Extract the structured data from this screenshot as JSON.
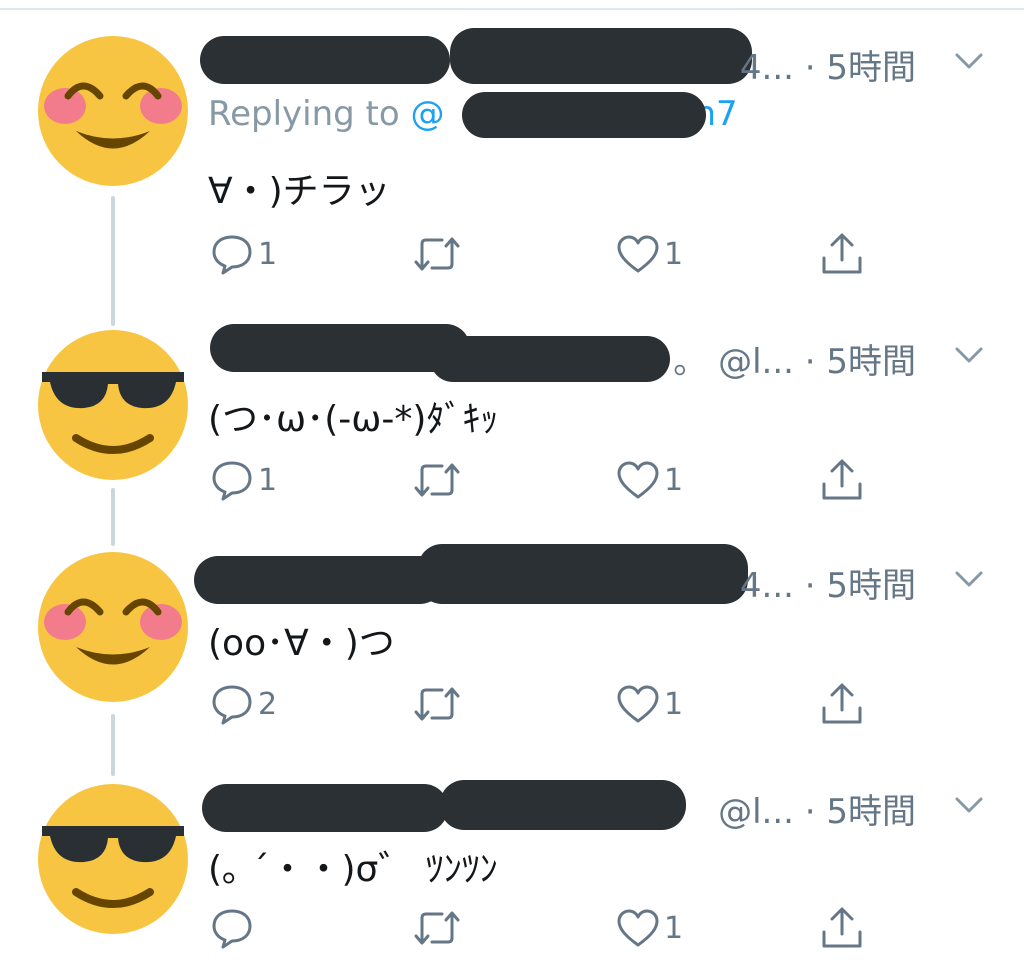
{
  "tweets": [
    {
      "avatar": "smiling-blush-emoji",
      "meta": "4... · 5時間",
      "reply_label": "Replying to",
      "reply_handle_prefix": "@",
      "reply_handle_suffix": "n7",
      "text": "∀・)チラッ",
      "replies": "1",
      "retweets": "",
      "likes": "1"
    },
    {
      "avatar": "sunglasses-emoji",
      "meta": "。 @l... · 5時間",
      "text": "(つ･ω･(-ω-*)ﾀﾞｷｯ",
      "replies": "1",
      "retweets": "",
      "likes": "1"
    },
    {
      "avatar": "smiling-blush-emoji",
      "meta": "4... · 5時間",
      "text": "(oo･∀・)つ",
      "replies": "2",
      "retweets": "",
      "likes": "1"
    },
    {
      "avatar": "sunglasses-emoji",
      "meta": "@l... · 5時間",
      "text": "(｡ ´・・)σ゛ ﾂﾝﾂﾝ",
      "replies": "",
      "retweets": "",
      "likes": "1"
    }
  ],
  "colors": {
    "emoji_face": "#f7c541",
    "emoji_blush": "#f27c8c",
    "emoji_features": "#664500",
    "redaction": "#2b3034",
    "link": "#1da1f2",
    "muted": "#657786",
    "thread_line": "#ccd6dd"
  },
  "icons": [
    "reply-icon",
    "retweet-icon",
    "like-icon",
    "share-icon",
    "chevron-down-icon"
  ]
}
